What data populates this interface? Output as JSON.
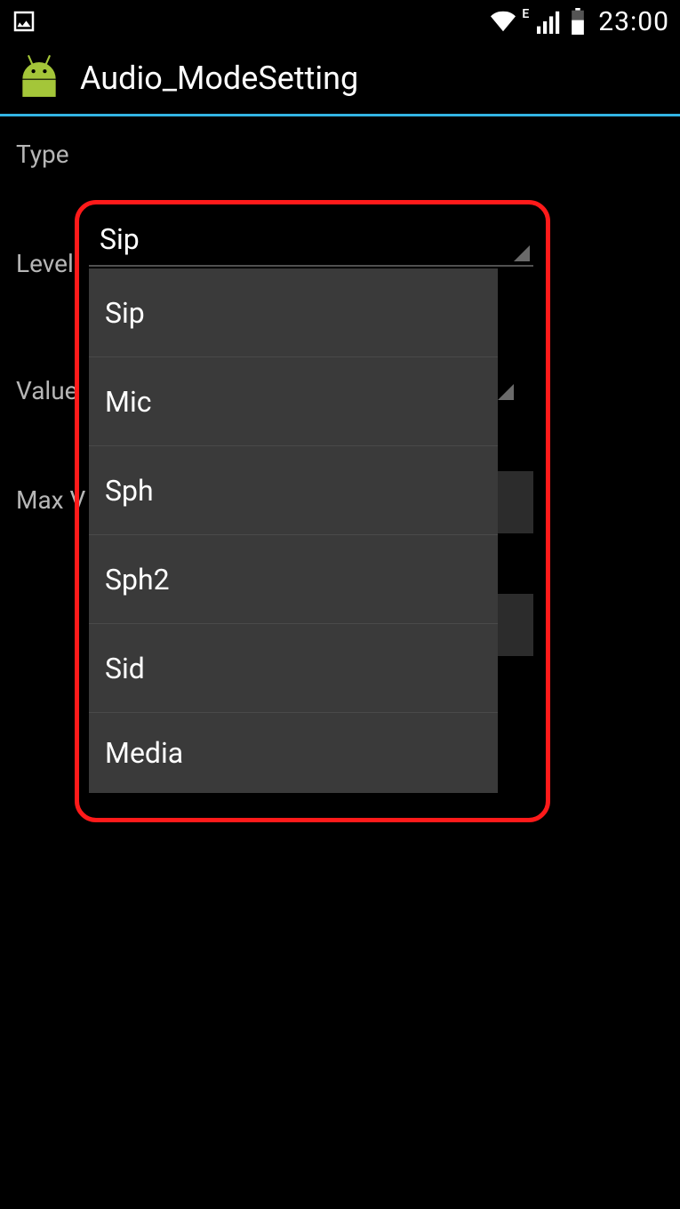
{
  "status_bar": {
    "edge_label": "E",
    "time": "23:00"
  },
  "action_bar": {
    "title": "Audio_ModeSetting"
  },
  "labels": {
    "type": "Type",
    "level": "Level",
    "value": "Value",
    "max_value": "Max V"
  },
  "spinner": {
    "selected": "Sip",
    "options": [
      "Sip",
      "Mic",
      "Sph",
      "Sph2",
      "Sid",
      "Media"
    ]
  }
}
